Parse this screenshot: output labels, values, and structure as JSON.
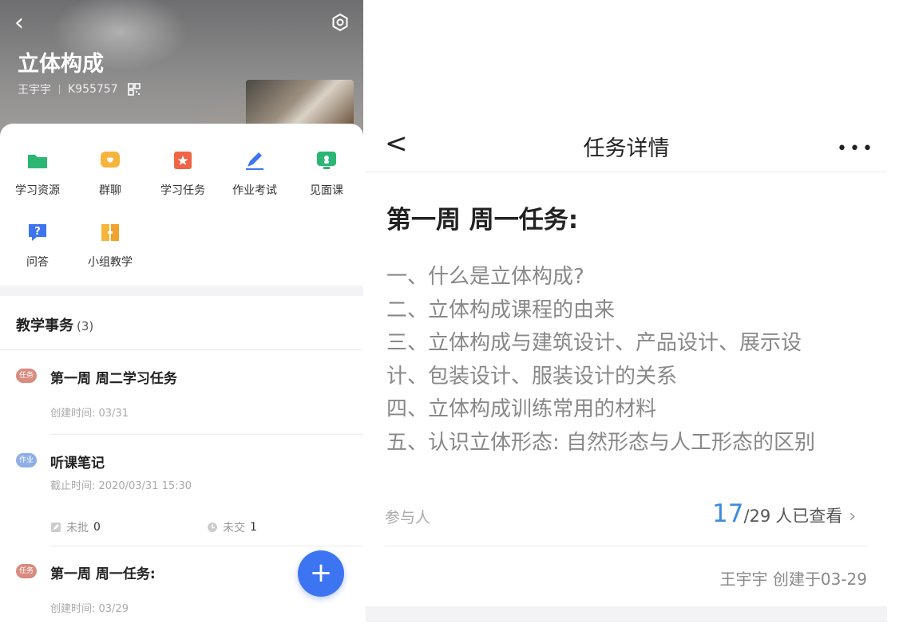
{
  "left": {
    "course": {
      "title": "立体构成",
      "teacher": "王宇宇",
      "code": "K955757"
    },
    "menu": [
      {
        "label": "学习资源",
        "icon": "folder-icon",
        "color": "#2bb673"
      },
      {
        "label": "群聊",
        "icon": "chat-icon",
        "color": "#f5b53d"
      },
      {
        "label": "学习任务",
        "icon": "flag-icon",
        "color": "#f06447"
      },
      {
        "label": "作业考试",
        "icon": "pencil-icon",
        "color": "#3d74f1"
      },
      {
        "label": "见面课",
        "icon": "live-icon",
        "color": "#2bb673"
      },
      {
        "label": "问答",
        "icon": "question-icon",
        "color": "#3d74f1"
      },
      {
        "label": "小组教学",
        "icon": "book-icon",
        "color": "#f5b53d"
      }
    ],
    "section": {
      "title": "教学事务",
      "count": "(3)"
    },
    "tasks": [
      {
        "tag": "任务",
        "tag_color": "#d98b80",
        "title": "第一周 周二学习任务",
        "meta": "创建时间: 03/31"
      },
      {
        "tag": "作业",
        "tag_color": "#8eaee8",
        "title": "听课笔记",
        "meta": "截止时间: 2020/03/31 15:30",
        "unmarked_label": "未批",
        "unmarked_value": "0",
        "unsubmitted_label": "未交",
        "unsubmitted_value": "1"
      },
      {
        "tag": "任务",
        "tag_color": "#d98b80",
        "title": "第一周 周一任务:",
        "meta": "创建时间: 03/29"
      }
    ],
    "fab_label": "+"
  },
  "right": {
    "header": {
      "back": "<",
      "title": "任务详情",
      "more": "•••"
    },
    "task_heading": "第一周 周一任务:",
    "content_lines": [
      "一、什么是立体构成?",
      "二、立体构成课程的由来",
      "三、立体构成与建筑设计、产品设计、展示设",
      "计、包装设计、服装设计的关系",
      "四、立体构成训练常用的材料",
      "五、认识立体形态: 自然形态与人工形态的区别"
    ],
    "participants_label": "参与人",
    "viewed_count": "17",
    "viewed_total": "/29",
    "viewed_suffix": "人已查看",
    "creator_line": "王宇宇 创建于03-29"
  }
}
